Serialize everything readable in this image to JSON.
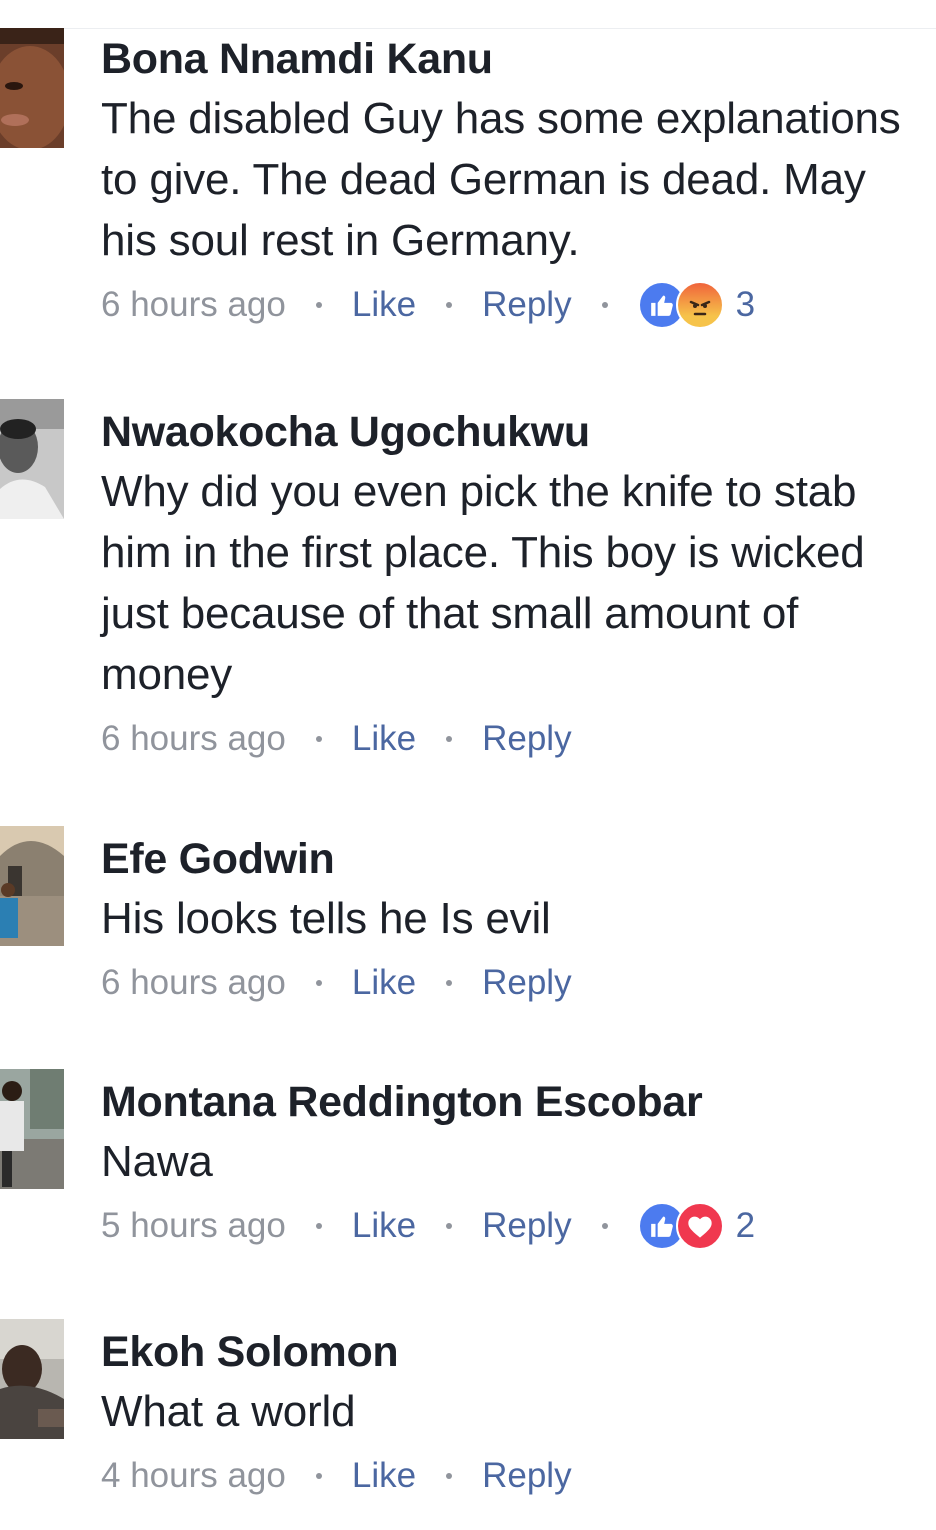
{
  "comments": [
    {
      "author": "Bona Nnamdi Kanu",
      "text": "The disabled Guy has some explanations to give. The dead German is dead. May his soul rest in Germany.",
      "time": "6 hours ago",
      "like_label": "Like",
      "reply_label": "Reply",
      "reactions": [
        "like",
        "angry"
      ],
      "reaction_count": "3"
    },
    {
      "author": "Nwaokocha Ugochukwu",
      "text": "Why did you even pick the knife to stab him in the first place. This boy is wicked just because of that small amount of money",
      "time": "6 hours ago",
      "like_label": "Like",
      "reply_label": "Reply"
    },
    {
      "author": "Efe Godwin",
      "text": "His looks tells he Is evil",
      "time": "6 hours ago",
      "like_label": "Like",
      "reply_label": "Reply"
    },
    {
      "author": "Montana Reddington Escobar",
      "text": "Nawa",
      "time": "5 hours ago",
      "like_label": "Like",
      "reply_label": "Reply",
      "reactions": [
        "like",
        "love"
      ],
      "reaction_count": "2"
    },
    {
      "author": "Ekoh Solomon",
      "text": "What a world",
      "time": "4 hours ago",
      "like_label": "Like",
      "reply_label": "Reply"
    }
  ],
  "colors": {
    "author": "#1d2129",
    "meta": "#90949c",
    "link": "#4b67a1",
    "like_reaction": "#4c7bef",
    "love_reaction": "#f0384f"
  }
}
